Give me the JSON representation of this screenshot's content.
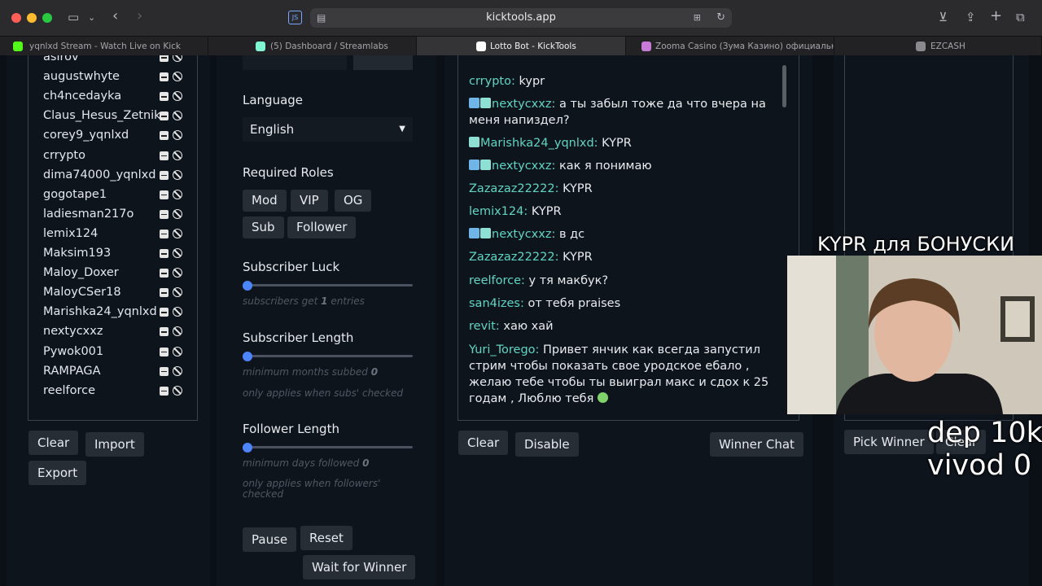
{
  "browser": {
    "address": "kicktools.app",
    "tabs": [
      {
        "title": "yqnlxd Stream - Watch Live on Kick"
      },
      {
        "title": "(5) Dashboard / Streamlabs"
      },
      {
        "title": "Lotto Bot - KickTools"
      },
      {
        "title": "Zooma Casino (Зума Казино) официальный с..."
      },
      {
        "title": "EZCASH"
      }
    ],
    "ext_label": "JS"
  },
  "excluded_users": [
    "asirov",
    "augustwhyte",
    "ch4ncedayka",
    "Claus_Hesus_Zetnik",
    "corey9_yqnlxd",
    "crrypto",
    "dima74000_yqnlxd",
    "gogotape1",
    "ladiesman217o",
    "lemix124",
    "Maksim193",
    "Maloy_Doxer",
    "MaloyCSer18",
    "Marishka24_yqnlxd",
    "nextycxxz",
    "Pywok001",
    "RAMPAGA",
    "reelforce"
  ],
  "list_buttons": {
    "clear": "Clear",
    "import": "Import",
    "export": "Export"
  },
  "settings": {
    "language_label": "Language",
    "language_value": "English",
    "roles_label": "Required Roles",
    "roles": [
      "Mod",
      "VIP",
      "OG",
      "Sub",
      "Follower"
    ],
    "sub_luck_label": "Subscriber Luck",
    "sub_luck_hint_pre": "subscribers get",
    "sub_luck_value": "1",
    "sub_luck_hint_post": "entries",
    "sub_len_label": "Subscriber Length",
    "sub_len_hint_pre": "minimum months subbed",
    "sub_len_value": "0",
    "sub_len_note": "only applies when subs' checked",
    "fol_len_label": "Follower Length",
    "fol_len_hint_pre": "minimum days followed",
    "fol_len_value": "0",
    "fol_len_note": "only applies when followers' checked",
    "pause": "Pause",
    "reset": "Reset",
    "wait": "Wait for Winner"
  },
  "chat": {
    "messages": [
      {
        "user": "crrypto",
        "text": "kypr"
      },
      {
        "user": "nextycxxz",
        "text": "а ты забыл тоже да что вчера на меня напиздел?"
      },
      {
        "user": "Marishka24_yqnlxd",
        "text": "KYPR"
      },
      {
        "user": "nextycxxz",
        "text": "как я понимаю"
      },
      {
        "user": "Zazazaz22222",
        "text": "KYPR"
      },
      {
        "user": "lemix124",
        "text": "KYPR"
      },
      {
        "user": "nextycxxz",
        "text": "в дс"
      },
      {
        "user": "Zazazaz22222",
        "text": "KYPR"
      },
      {
        "user": "reelforce",
        "text": "у тя макбук?"
      },
      {
        "user": "san4izes",
        "text": "от тебя praises"
      },
      {
        "user": "revit",
        "text": "хаю хай"
      },
      {
        "user": "Yuri_Torego",
        "text": "Привет янчик как всегда запустил стрим чтобы показать свое уродское ебало , желаю тебе чтобы ты выиграл макс и сдох к 25 годам , Люблю тебя"
      }
    ],
    "clear": "Clear",
    "disable": "Disable",
    "winner_chat": "Winner Chat"
  },
  "winner": {
    "pick": "Pick Winner",
    "clear": "Clear"
  },
  "stream_overlay": {
    "headline": "KYPR для БОНУСКИ",
    "dep": "dep 10k",
    "vivod": "vivod 0"
  }
}
